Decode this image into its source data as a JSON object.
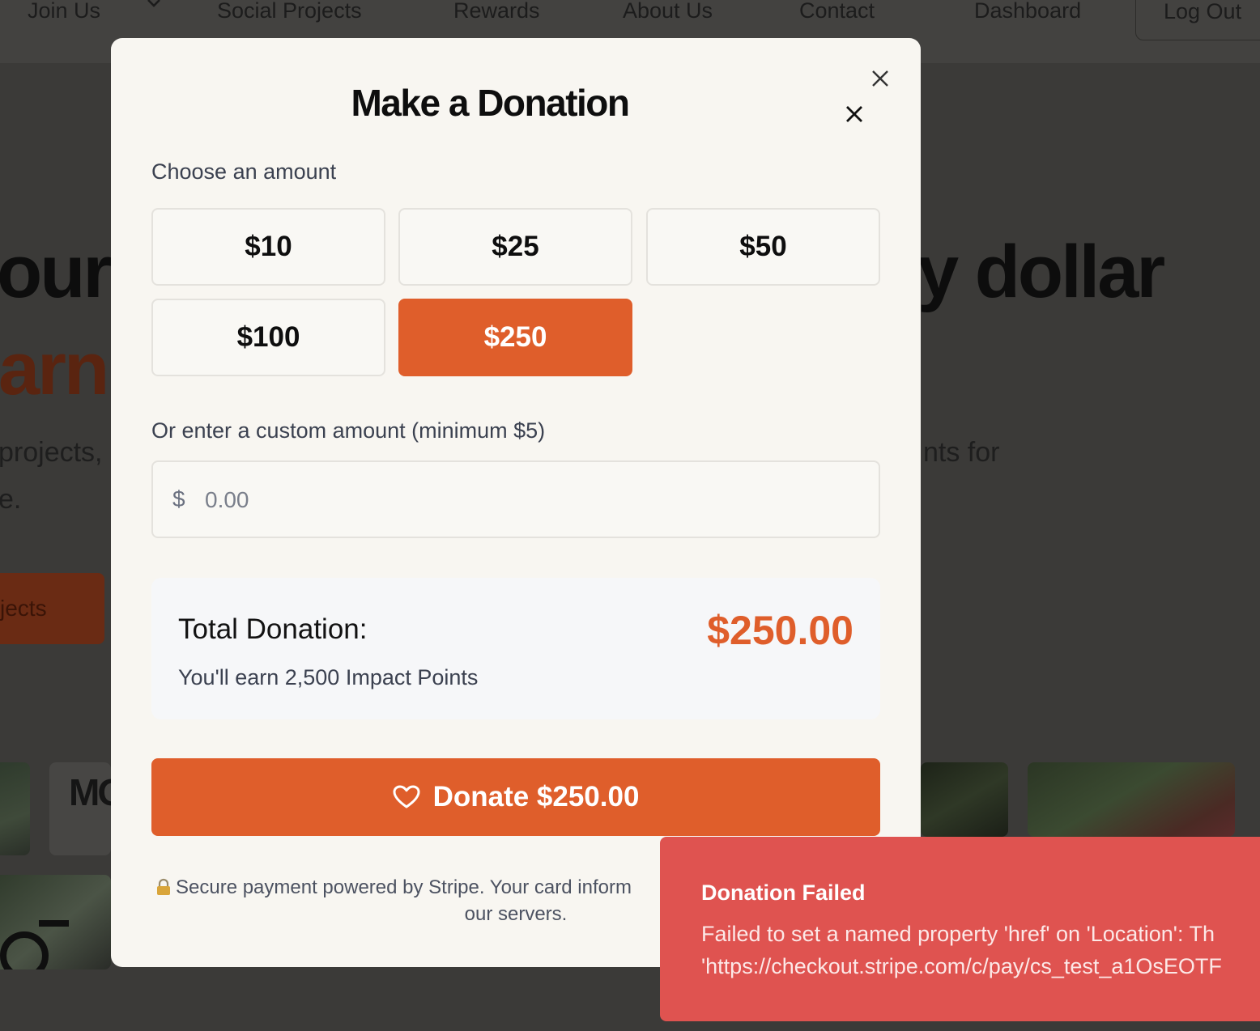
{
  "nav": {
    "join_us": "Join Us",
    "social_projects": "Social Projects",
    "rewards": "Rewards",
    "about_us": "About Us",
    "contact": "Contact",
    "dashboard": "Dashboard",
    "log_out": "Log Out"
  },
  "background": {
    "hero_line1_left": "our",
    "hero_line1_right": "y dollar",
    "hero_line2_left": "arn",
    "sub_line1_left": "projects,",
    "sub_line1_right": "nts for",
    "sub_line2_left": "e.",
    "cta_fragment": "jects",
    "thumb_text": "MO"
  },
  "modal": {
    "title": "Make a Donation",
    "choose_label": "Choose an amount",
    "amounts": [
      "$10",
      "$25",
      "$50",
      "$100",
      "$250"
    ],
    "selected_amount": "$250",
    "custom_label": "Or enter a custom amount (minimum $5)",
    "currency_symbol": "$",
    "custom_placeholder": "0.00",
    "total_label": "Total Donation:",
    "total_value": "$250.00",
    "points_text": "You'll earn 2,500 Impact Points",
    "donate_label": "Donate $250.00",
    "secure_note_line1": "Secure payment powered by Stripe. Your card inform",
    "secure_note_line2": "our servers."
  },
  "toast": {
    "title": "Donation Failed",
    "message_line1": "Failed to set a named property 'href' on 'Location': Th",
    "message_line2": "'https://checkout.stripe.com/c/pay/cs_test_a1OsEOTF"
  },
  "colors": {
    "accent": "#df5e2b",
    "error": "#df5350",
    "modal_bg": "#f8f6f1"
  }
}
